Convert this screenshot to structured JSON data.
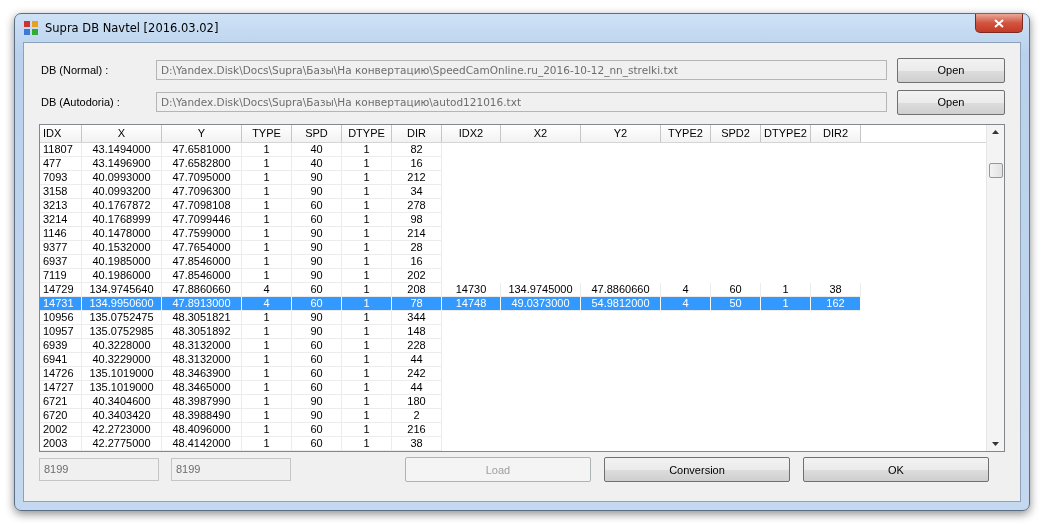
{
  "window": {
    "title": "Supra DB Navtel [2016.03.02]"
  },
  "sources": [
    {
      "label": "DB (Normal) :",
      "value": "D:\\Yandex.Disk\\Docs\\Supra\\Базы\\На конвертацию\\SpeedCamOnline.ru_2016-10-12_nn_strelki.txt",
      "button": "Open"
    },
    {
      "label": "DB (Autodoria) :",
      "value": "D:\\Yandex.Disk\\Docs\\Supra\\Базы\\На конвертацию\\autod121016.txt",
      "button": "Open"
    }
  ],
  "table": {
    "columns": [
      "IDX",
      "X",
      "Y",
      "TYPE",
      "SPD",
      "DTYPE",
      "DIR",
      "IDX2",
      "X2",
      "Y2",
      "TYPE2",
      "SPD2",
      "DTYPE2",
      "DIR2"
    ],
    "rows": [
      {
        "selected": false,
        "cells": [
          "11807",
          "43.1494000",
          "47.6581000",
          "1",
          "40",
          "1",
          "82"
        ]
      },
      {
        "selected": false,
        "cells": [
          "477",
          "43.1496900",
          "47.6582800",
          "1",
          "40",
          "1",
          "16"
        ]
      },
      {
        "selected": false,
        "cells": [
          "7093",
          "40.0993000",
          "47.7095000",
          "1",
          "90",
          "1",
          "212"
        ]
      },
      {
        "selected": false,
        "cells": [
          "3158",
          "40.0993200",
          "47.7096300",
          "1",
          "90",
          "1",
          "34"
        ]
      },
      {
        "selected": false,
        "cells": [
          "3213",
          "40.1767872",
          "47.7098108",
          "1",
          "60",
          "1",
          "278"
        ]
      },
      {
        "selected": false,
        "cells": [
          "3214",
          "40.1768999",
          "47.7099446",
          "1",
          "60",
          "1",
          "98"
        ]
      },
      {
        "selected": false,
        "cells": [
          "1146",
          "40.1478000",
          "47.7599000",
          "1",
          "90",
          "1",
          "214"
        ]
      },
      {
        "selected": false,
        "cells": [
          "9377",
          "40.1532000",
          "47.7654000",
          "1",
          "90",
          "1",
          "28"
        ]
      },
      {
        "selected": false,
        "cells": [
          "6937",
          "40.1985000",
          "47.8546000",
          "1",
          "90",
          "1",
          "16"
        ]
      },
      {
        "selected": false,
        "cells": [
          "7119",
          "40.1986000",
          "47.8546000",
          "1",
          "90",
          "1",
          "202"
        ]
      },
      {
        "selected": false,
        "cells": [
          "14729",
          "134.9745640",
          "47.8860660",
          "4",
          "60",
          "1",
          "208",
          "14730",
          "134.9745000",
          "47.8860660",
          "4",
          "60",
          "1",
          "38"
        ]
      },
      {
        "selected": true,
        "cells": [
          "14731",
          "134.9950600",
          "47.8913000",
          "4",
          "60",
          "1",
          "78",
          "14748",
          "49.0373000",
          "54.9812000",
          "4",
          "50",
          "1",
          "162"
        ]
      },
      {
        "selected": false,
        "cells": [
          "10956",
          "135.0752475",
          "48.3051821",
          "1",
          "90",
          "1",
          "344"
        ]
      },
      {
        "selected": false,
        "cells": [
          "10957",
          "135.0752985",
          "48.3051892",
          "1",
          "90",
          "1",
          "148"
        ]
      },
      {
        "selected": false,
        "cells": [
          "6939",
          "40.3228000",
          "48.3132000",
          "1",
          "60",
          "1",
          "228"
        ]
      },
      {
        "selected": false,
        "cells": [
          "6941",
          "40.3229000",
          "48.3132000",
          "1",
          "60",
          "1",
          "44"
        ]
      },
      {
        "selected": false,
        "cells": [
          "14726",
          "135.1019000",
          "48.3463900",
          "1",
          "60",
          "1",
          "242"
        ]
      },
      {
        "selected": false,
        "cells": [
          "14727",
          "135.1019000",
          "48.3465000",
          "1",
          "60",
          "1",
          "44"
        ]
      },
      {
        "selected": false,
        "cells": [
          "6721",
          "40.3404600",
          "48.3987990",
          "1",
          "90",
          "1",
          "180"
        ]
      },
      {
        "selected": false,
        "cells": [
          "6720",
          "40.3403420",
          "48.3988490",
          "1",
          "90",
          "1",
          "2"
        ]
      },
      {
        "selected": false,
        "cells": [
          "2002",
          "42.2723000",
          "48.4096000",
          "1",
          "60",
          "1",
          "216"
        ]
      },
      {
        "selected": false,
        "cells": [
          "2003",
          "42.2775000",
          "48.4142000",
          "1",
          "60",
          "1",
          "38"
        ]
      }
    ]
  },
  "counts": [
    "8199",
    "8199"
  ],
  "buttons": [
    {
      "label": "Load",
      "disabled": true
    },
    {
      "label": "Conversion",
      "disabled": false
    },
    {
      "label": "OK",
      "disabled": false
    }
  ]
}
